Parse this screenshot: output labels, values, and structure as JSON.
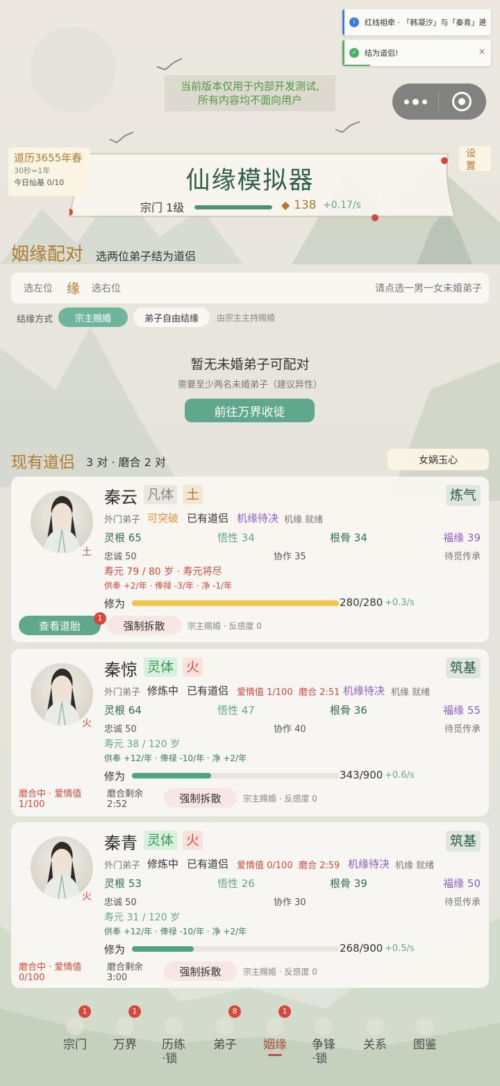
{
  "toasts": [
    {
      "text": "红线相牵 · 「韩凝汐」与「秦青」进",
      "icon": "info-icon",
      "close": "×"
    },
    {
      "text": "结为道侣!",
      "icon": "check-icon",
      "close": "×"
    }
  ],
  "notice": {
    "line1": "当前版本仅用于内部开发测试,",
    "line2": "所有内容均不面向用户"
  },
  "calendar": {
    "date": "道历3655年春",
    "ratio": "30秒=1年",
    "daily": "今日仙基 0/10"
  },
  "settings_label": "设置",
  "title": "仙缘模拟器",
  "sect": {
    "level": "宗门 1级",
    "currency": "138",
    "rate": "+0.17/s",
    "progress": 1.0
  },
  "marriage": {
    "heading": "姻缘配对",
    "subheading": "选两位弟子结为道侣",
    "left_slot": "选左位",
    "center": "缘",
    "right_slot": "选右位",
    "hint": "请点选一男一女未婚弟子",
    "mode_label": "结缘方式",
    "mode_options": [
      "宗主赐婚",
      "弟子自由结缘"
    ],
    "mode_note": "由宗主主持赐婚",
    "empty_title": "暂无未婚弟子可配对",
    "empty_sub": "需要至少两名未婚弟子（建议异性）",
    "recruit_button": "前往万界收徒"
  },
  "couples": {
    "heading": "现有道侣",
    "summary": "3 对 · 磨合 2 对",
    "item_button": "女娲玉心"
  },
  "disciples": [
    {
      "name": "秦云",
      "body": "凡体",
      "element": "土",
      "realm": "炼气",
      "rank": "外门弟子",
      "status": "可突破",
      "partner": "已有道侣",
      "love": "",
      "break_in": "",
      "chance": "机缘待决",
      "chance2": "机缘 就绪",
      "linggen": "灵根 65",
      "wuxing": "悟性 34",
      "gengu": "根骨 34",
      "fuyuan": "福缘 39",
      "loyalty": "忠诚 50",
      "coop": "协作 35",
      "inherit": "待觅传承",
      "life": "寿元 79 / 80 岁 · 寿元将尽",
      "pay": "供奉 +2/年 · 俸禄 -3/年 · 净 -1/年",
      "cult_label": "修为",
      "cult_val": "280/280",
      "cult_rate": "+0.3/s",
      "cult_progress": 1.0,
      "left_note1": "",
      "left_note2": "",
      "mid_note1": "",
      "mid_note2": "",
      "action1": "查看道胎",
      "action1_badge": "1",
      "action2": "强制拆散",
      "foot": "宗主赐婚 · 反感度 0"
    },
    {
      "name": "秦惊",
      "body": "灵体",
      "element": "火",
      "realm": "筑基",
      "rank": "外门弟子",
      "status": "修炼中",
      "partner": "已有道侣",
      "love": "爱情值 1/100",
      "break_in": "磨合 2:51",
      "chance": "机缘待决",
      "chance2": "机缘 就绪",
      "linggen": "灵根 64",
      "wuxing": "悟性 47",
      "gengu": "根骨 36",
      "fuyuan": "福缘 55",
      "loyalty": "忠诚 50",
      "coop": "协作 40",
      "inherit": "待觅传承",
      "life": "寿元 38 / 120 岁",
      "pay": "供奉 +12/年 · 俸禄 -10/年 · 净 +2/年",
      "cult_label": "修为",
      "cult_val": "343/900",
      "cult_rate": "+0.6/s",
      "cult_progress": 0.381,
      "left_note1": "磨合中 · 爱情值",
      "left_note2": "1/100",
      "mid_note1": "磨合剩余",
      "mid_note2": "2:52",
      "action1": "",
      "action1_badge": "",
      "action2": "强制拆散",
      "foot": "宗主赐婚 · 反感度 0"
    },
    {
      "name": "秦青",
      "body": "灵体",
      "element": "火",
      "realm": "筑基",
      "rank": "外门弟子",
      "status": "修炼中",
      "partner": "已有道侣",
      "love": "爱情值 0/100",
      "break_in": "磨合 2:59",
      "chance": "机缘待决",
      "chance2": "机缘 就绪",
      "linggen": "灵根 53",
      "wuxing": "悟性 26",
      "gengu": "根骨 39",
      "fuyuan": "福缘 50",
      "loyalty": "忠诚 50",
      "coop": "协作 30",
      "inherit": "待觅传承",
      "life": "寿元 31 / 120 岁",
      "pay": "供奉 +12/年 · 俸禄 -10/年 · 净 +2/年",
      "cult_label": "修为",
      "cult_val": "268/900",
      "cult_rate": "+0.5/s",
      "cult_progress": 0.298,
      "left_note1": "磨合中 · 爱情值",
      "left_note2": "0/100",
      "mid_note1": "磨合剩余",
      "mid_note2": "3:00",
      "action1": "",
      "action1_badge": "",
      "action2": "强制拆散",
      "foot": "宗主赐婚 · 反感度 0"
    }
  ],
  "nav": [
    {
      "label": "宗门",
      "badge": "1",
      "icon": "sect-icon"
    },
    {
      "label": "万界",
      "badge": "1",
      "icon": "gate-icon"
    },
    {
      "label": "历练·锁",
      "badge": "",
      "icon": "journey-icon"
    },
    {
      "label": "弟子",
      "badge": "8",
      "icon": "disciple-icon"
    },
    {
      "label": "姻缘",
      "badge": "1",
      "icon": "marriage-icon",
      "active": true
    },
    {
      "label": "争锋·锁",
      "badge": "",
      "icon": "contest-icon"
    },
    {
      "label": "关系",
      "badge": "",
      "icon": "relation-icon"
    },
    {
      "label": "图鉴",
      "badge": "",
      "icon": "codex-icon"
    }
  ],
  "colors": {
    "accent": "#5fa88e",
    "gold": "#b07b2f",
    "love": "#d04a3a",
    "purple": "#8b5fc0",
    "cult_gold": "#f5c24a",
    "cult_green": "#4fa386"
  }
}
